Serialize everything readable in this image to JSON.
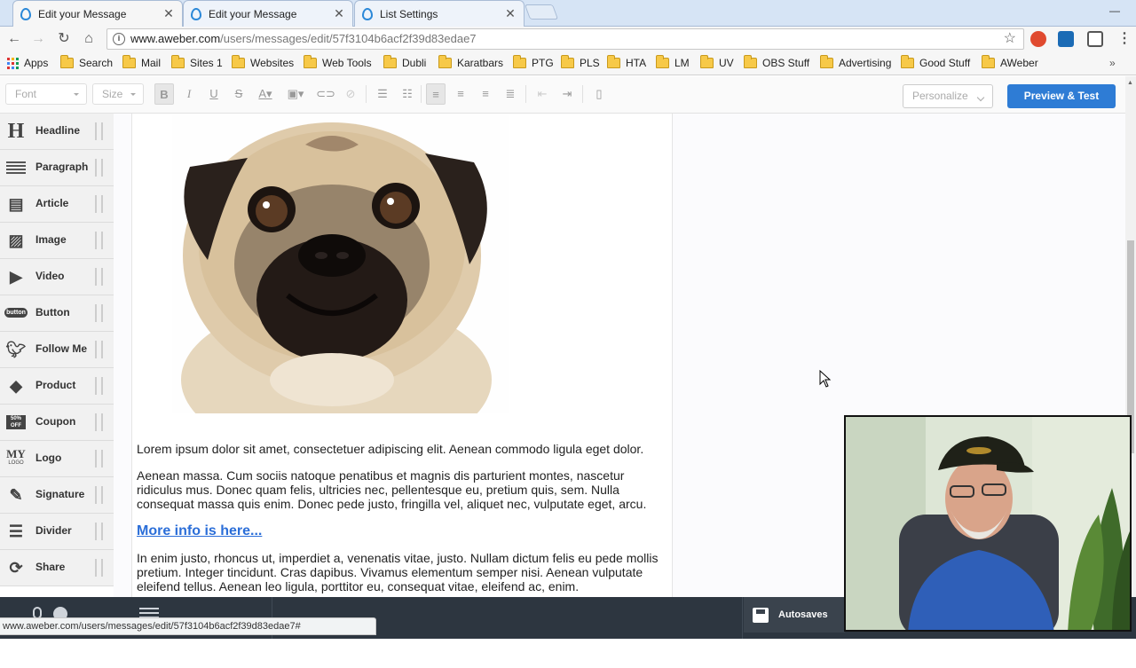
{
  "browser": {
    "tabs": [
      {
        "title": "Edit your Message",
        "active": true
      },
      {
        "title": "Edit your Message",
        "active": false
      },
      {
        "title": "List Settings",
        "active": false
      }
    ],
    "url_host": "www.aweber.com",
    "url_path": "/users/messages/edit/57f3104b6acf2f39d83edae7",
    "bookmarks": [
      "Apps",
      "Search",
      "Mail",
      "Sites 1",
      "Websites",
      "Web Tools",
      "Dubli",
      "Karatbars",
      "PTG",
      "PLS",
      "HTA",
      "LM",
      "UV",
      "OBS Stuff",
      "Advertising",
      "Good Stuff",
      "AWeber"
    ],
    "status_url": "www.aweber.com/users/messages/edit/57f3104b6acf2f39d83edae7#"
  },
  "format_toolbar": {
    "font_placeholder": "Font",
    "size_placeholder": "Size",
    "personalize_label": "Personalize",
    "preview_label": "Preview & Test"
  },
  "blocks": [
    {
      "label": "Headline",
      "icon": "headline-icon"
    },
    {
      "label": "Paragraph",
      "icon": "paragraph-icon"
    },
    {
      "label": "Article",
      "icon": "article-icon"
    },
    {
      "label": "Image",
      "icon": "image-icon"
    },
    {
      "label": "Video",
      "icon": "video-icon"
    },
    {
      "label": "Button",
      "icon": "button-icon"
    },
    {
      "label": "Follow Me",
      "icon": "twitter-bird-icon"
    },
    {
      "label": "Product",
      "icon": "tag-icon"
    },
    {
      "label": "Coupon",
      "icon": "coupon-icon"
    },
    {
      "label": "Logo",
      "icon": "logo-icon"
    },
    {
      "label": "Signature",
      "icon": "pen-icon"
    },
    {
      "label": "Divider",
      "icon": "divider-icon"
    },
    {
      "label": "Share",
      "icon": "share-icon"
    }
  ],
  "block_icon_text": {
    "button": "button",
    "coupon": "50% OFF",
    "logo_top": "MY",
    "logo_bottom": "LOGO"
  },
  "message": {
    "paragraph1": "Lorem ipsum dolor sit amet, consectetuer adipiscing elit. Aenean commodo ligula eget dolor.",
    "paragraph2": "Aenean massa. Cum sociis natoque penatibus et magnis dis parturient montes, nascetur ridiculus mus. Donec quam felis, ultricies nec, pellentesque eu, pretium quis, sem. Nulla consequat massa quis enim. Donec pede justo, fringilla vel, aliquet nec, vulputate eget, arcu.",
    "link": "More info is here...",
    "paragraph3": "In enim justo, rhoncus ut, imperdiet a, venenatis vitae, justo. Nullam dictum felis eu pede mollis pretium. Integer tincidunt. Cras dapibus. Vivamus elementum semper nisi. Aenean vulputate eleifend tellus. Aenean leo ligula, porttitor eu, consequat vitae, eleifend ac, enim."
  },
  "bottom_bar": {
    "autosaves_label": "Autosaves (10)"
  },
  "colors": {
    "primary_button": "#2e7cd5",
    "link": "#2b6ed8",
    "bottom_bar": "#2d3640",
    "tab_strip": "#d6e4f5"
  }
}
